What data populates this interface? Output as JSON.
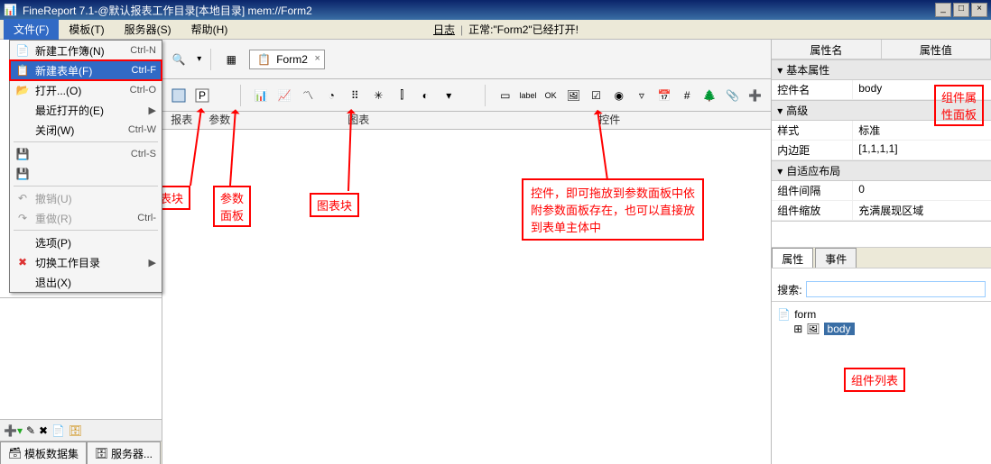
{
  "title": "FineReport 7.1-@默认报表工作目录[本地目录]    mem://Form2",
  "window_buttons": {
    "min": "_",
    "max": "□",
    "close": "×"
  },
  "menu": {
    "file": "文件(F)",
    "template": "模板(T)",
    "server": "服务器(S)",
    "help": "帮助(H)"
  },
  "status_top": {
    "log": "日志",
    "sep": "|",
    "msg": "正常:\"Form2\"已经打开!"
  },
  "file_menu": [
    {
      "icon": "📄",
      "label": "新建工作簿(N)",
      "shortcut": "Ctrl-N",
      "interact": true
    },
    {
      "icon": "📋",
      "label": "新建表单(F)",
      "shortcut": "Ctrl-F",
      "highlight": true,
      "interact": true,
      "redbox": true
    },
    {
      "icon": "📂",
      "label": "打开...(O)",
      "shortcut": "Ctrl-O",
      "interact": true
    },
    {
      "icon": "",
      "label": "最近打开的(E)",
      "shortcut": "▶",
      "interact": true
    },
    {
      "icon": "",
      "label": "关闭(W)",
      "shortcut": "Ctrl-W",
      "interact": true
    },
    {
      "sep": true
    },
    {
      "icon": "💾",
      "label": "",
      "shortcut": "Ctrl-S",
      "disabled": true,
      "interact": false
    },
    {
      "icon": "💾",
      "label": "",
      "shortcut": "",
      "disabled": true,
      "interact": false
    },
    {
      "sep": true
    },
    {
      "icon": "↶",
      "label": "撤销(U)",
      "shortcut": "",
      "disabled": true,
      "interact": false
    },
    {
      "icon": "↷",
      "label": "重做(R)",
      "shortcut": "Ctrl-",
      "disabled": true,
      "interact": false
    },
    {
      "sep": true
    },
    {
      "icon": "",
      "label": "选项(P)",
      "shortcut": "",
      "interact": true
    },
    {
      "icon": "✖",
      "label": "切换工作目录",
      "shortcut": "▶",
      "interact": true,
      "iconColor": "#d33"
    },
    {
      "icon": "",
      "label": "退出(X)",
      "shortcut": "",
      "interact": true
    }
  ],
  "left_tabs": {
    "t1": "模板数据集",
    "t2": "服务器..."
  },
  "center": {
    "tab_label": "Form2",
    "group_labels": {
      "g1": "报表",
      "g2": "参数",
      "g3": "图表",
      "g4": "控件"
    }
  },
  "props": {
    "header": {
      "name": "属性名",
      "value": "属性值"
    },
    "sections": {
      "basic": "基本属性",
      "advanced": "高级",
      "adaptive": "自适应布局"
    },
    "rows": {
      "ctrl_name_k": "控件名",
      "ctrl_name_v": "body",
      "style_k": "样式",
      "style_v": "标准",
      "padding_k": "内边距",
      "padding_v": "[1,1,1,1]",
      "gap_k": "组件间隔",
      "gap_v": "0",
      "scale_k": "组件缩放",
      "scale_v": "充满展现区域"
    },
    "tabs": {
      "t1": "属性",
      "t2": "事件"
    },
    "search_label": "搜索:",
    "tree": {
      "root": "form",
      "child": "body"
    }
  },
  "callouts": {
    "c_newform": "新建表单",
    "c_report": "报表块",
    "c_param": "参数\n面板",
    "c_chart": "图表块",
    "c_widget": "控件，即可拖放到参数面板中依\n附参数面板存在，也可以直接放\n到表单主体中",
    "c_proppanel": "组件属\n性面板",
    "c_complist": "组件列表"
  }
}
